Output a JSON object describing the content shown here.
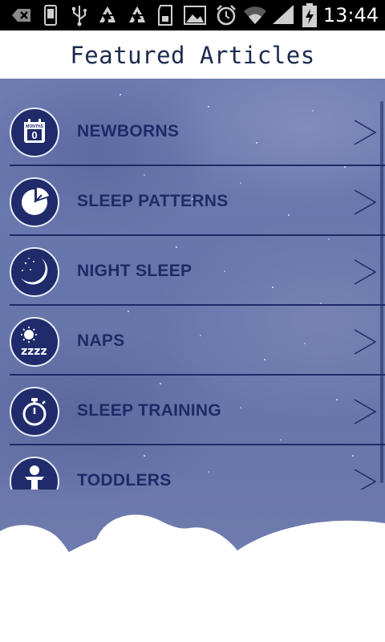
{
  "status_bar": {
    "time": "13:44",
    "icons": [
      "back-icon",
      "phone-icon",
      "usb-icon",
      "recycle-icon",
      "recycle-icon",
      "sd-card-icon",
      "image-icon",
      "alarm-clock-icon",
      "wifi-icon",
      "signal-icon",
      "battery-charging-icon"
    ]
  },
  "header": {
    "title": "Featured Articles"
  },
  "articles": [
    {
      "label": "NEWBORNS",
      "icon": "calendar-icon",
      "calendar_header": "MONTHS",
      "calendar_value": "0"
    },
    {
      "label": "SLEEP PATTERNS",
      "icon": "pie-chart-icon"
    },
    {
      "label": "NIGHT SLEEP",
      "icon": "moon-icon"
    },
    {
      "label": "NAPS",
      "icon": "sun-zzz-icon",
      "icon_text": "zzzz"
    },
    {
      "label": "SLEEP TRAINING",
      "icon": "stopwatch-icon"
    },
    {
      "label": "TODDLERS",
      "icon": "child-icon"
    }
  ],
  "colors": {
    "accent": "#1e2a66",
    "background": "#6a77ab",
    "title_text": "#1b2a4d"
  }
}
